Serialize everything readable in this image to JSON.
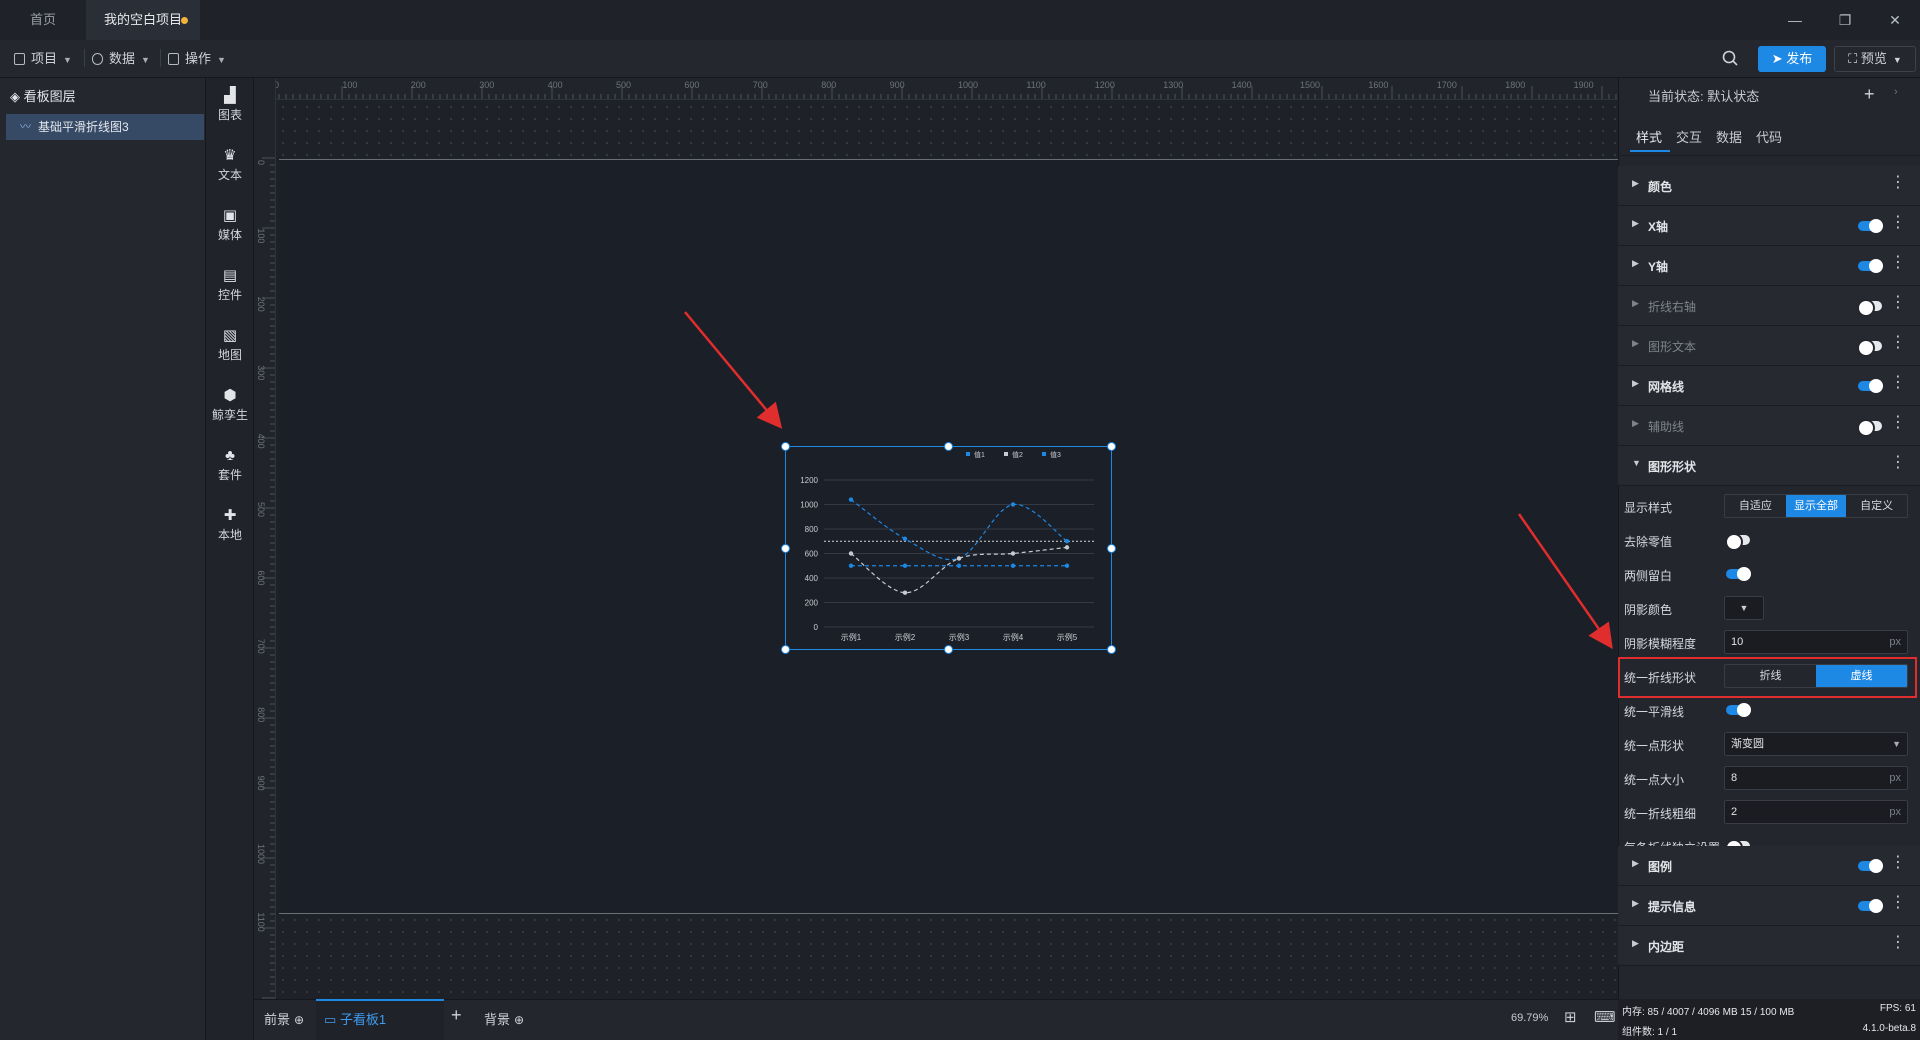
{
  "titlebar": {
    "tab_home": "首页",
    "tab_project": "我的空白项目"
  },
  "menubar": {
    "items": [
      "项目",
      "数据",
      "操作"
    ],
    "publish": "发布",
    "preview": "预览"
  },
  "layers": {
    "title": "看板图层",
    "items": [
      "基础平滑折线图3"
    ]
  },
  "toolbar": {
    "items": [
      "图表",
      "文本",
      "媒体",
      "控件",
      "地图",
      "鲸孪生",
      "套件",
      "本地"
    ]
  },
  "ruler": {
    "top_ticks": [
      "0",
      "100",
      "200",
      "300",
      "400",
      "500",
      "600",
      "700",
      "800",
      "900",
      "1000",
      "1100",
      "1200",
      "1300",
      "1400",
      "1500",
      "1600",
      "1700",
      "1800",
      "1900"
    ],
    "left_ticks": [
      "0",
      "100",
      "200",
      "300",
      "400",
      "500",
      "600",
      "700",
      "800",
      "900",
      "1000",
      "1100"
    ]
  },
  "chart_data": {
    "type": "line",
    "categories": [
      "示例1",
      "示例2",
      "示例3",
      "示例4",
      "示例5"
    ],
    "series": [
      {
        "name": "值1",
        "values": [
          1040,
          720,
          560,
          1000,
          700
        ],
        "color": "#1e88e5"
      },
      {
        "name": "值2",
        "values": [
          600,
          280,
          560,
          600,
          650
        ],
        "color": "#c8cbd2"
      },
      {
        "name": "值3",
        "values": [
          500,
          500,
          500,
          500,
          500
        ],
        "color": "#1e88e5"
      }
    ],
    "yticks": [
      "1200",
      "1000",
      "800",
      "600",
      "400",
      "200",
      "0"
    ],
    "ylim": [
      0,
      1200
    ],
    "reference_line": 700,
    "line_style": "dashed",
    "smooth": true,
    "legend_position": "top-right",
    "grid": true
  },
  "bottombar": {
    "front": "前景",
    "board": "子看板1",
    "back": "背景",
    "zoom": "69.79%"
  },
  "panel": {
    "state_label": "当前状态:",
    "state_value": "默认状态",
    "tabs": [
      "样式",
      "交互",
      "数据",
      "代码"
    ],
    "sections_top": [
      {
        "label": "颜色",
        "toggle": null,
        "dim": false
      },
      {
        "label": "X轴",
        "toggle": true,
        "dim": false
      },
      {
        "label": "Y轴",
        "toggle": true,
        "dim": false
      },
      {
        "label": "折线右轴",
        "toggle": false,
        "dim": true
      },
      {
        "label": "图形文本",
        "toggle": false,
        "dim": true
      },
      {
        "label": "网格线",
        "toggle": true,
        "dim": false
      },
      {
        "label": "辅助线",
        "toggle": false,
        "dim": true
      },
      {
        "label": "图形形状",
        "toggle": null,
        "dim": false,
        "expanded": true
      }
    ],
    "shape": {
      "display_style_label": "显示样式",
      "display_style_options": [
        "自适应",
        "显示全部",
        "自定义"
      ],
      "display_style_selected": "显示全部",
      "remove_zero_label": "去除零值",
      "remove_zero": false,
      "side_gap_label": "两侧留白",
      "side_gap": true,
      "shadow_color_label": "阴影颜色",
      "shadow_blur_label": "阴影模糊程度",
      "shadow_blur_value": "10",
      "unit_px": "px",
      "line_shape_label": "统一折线形状",
      "line_shape_options": [
        "折线",
        "虚线"
      ],
      "line_shape_selected": "虚线",
      "smooth_label": "统一平滑线",
      "smooth": true,
      "point_shape_label": "统一点形状",
      "point_shape_value": "渐变圆",
      "point_size_label": "统一点大小",
      "point_size_value": "8",
      "line_width_label": "统一折线粗细",
      "line_width_value": "2",
      "independent_label": "每条折线独立设置",
      "independent": false
    },
    "sections_bottom": [
      {
        "label": "图例",
        "toggle": true
      },
      {
        "label": "提示信息",
        "toggle": true
      },
      {
        "label": "内边距",
        "toggle": null
      }
    ]
  },
  "status": {
    "memory": "内存: 85 / 4007 / 4096 MB 15 / 100 MB",
    "fps": "FPS: 61",
    "components": "组件数: 1 / 1",
    "version": "4.1.0-beta.8"
  },
  "colors": {
    "accent": "#1e88e5",
    "annotation": "#e02d2d",
    "unsaved_dot": "#f2b43c"
  }
}
